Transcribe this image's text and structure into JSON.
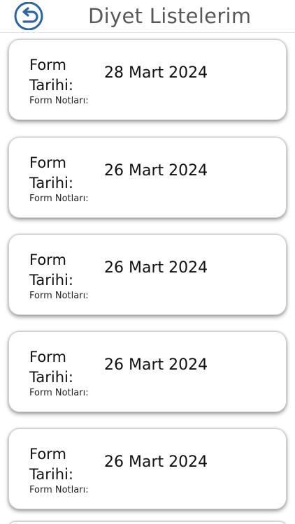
{
  "header": {
    "title": "Diyet Listelerim",
    "back_icon": "back-arrow-icon",
    "accent_color": "#2e64a3",
    "title_color": "#585858"
  },
  "forms": [
    {
      "label": "Form Tarihi:",
      "date": "28 Mart 2024",
      "notes_label": "Form Notları:"
    },
    {
      "label": "Form Tarihi:",
      "date": "26 Mart 2024",
      "notes_label": "Form Notları:"
    },
    {
      "label": "Form Tarihi:",
      "date": "26 Mart 2024",
      "notes_label": "Form Notları:"
    },
    {
      "label": "Form Tarihi:",
      "date": "26 Mart 2024",
      "notes_label": "Form Notları:"
    },
    {
      "label": "Form Tarihi:",
      "date": "26 Mart 2024",
      "notes_label": "Form Notları:"
    }
  ]
}
